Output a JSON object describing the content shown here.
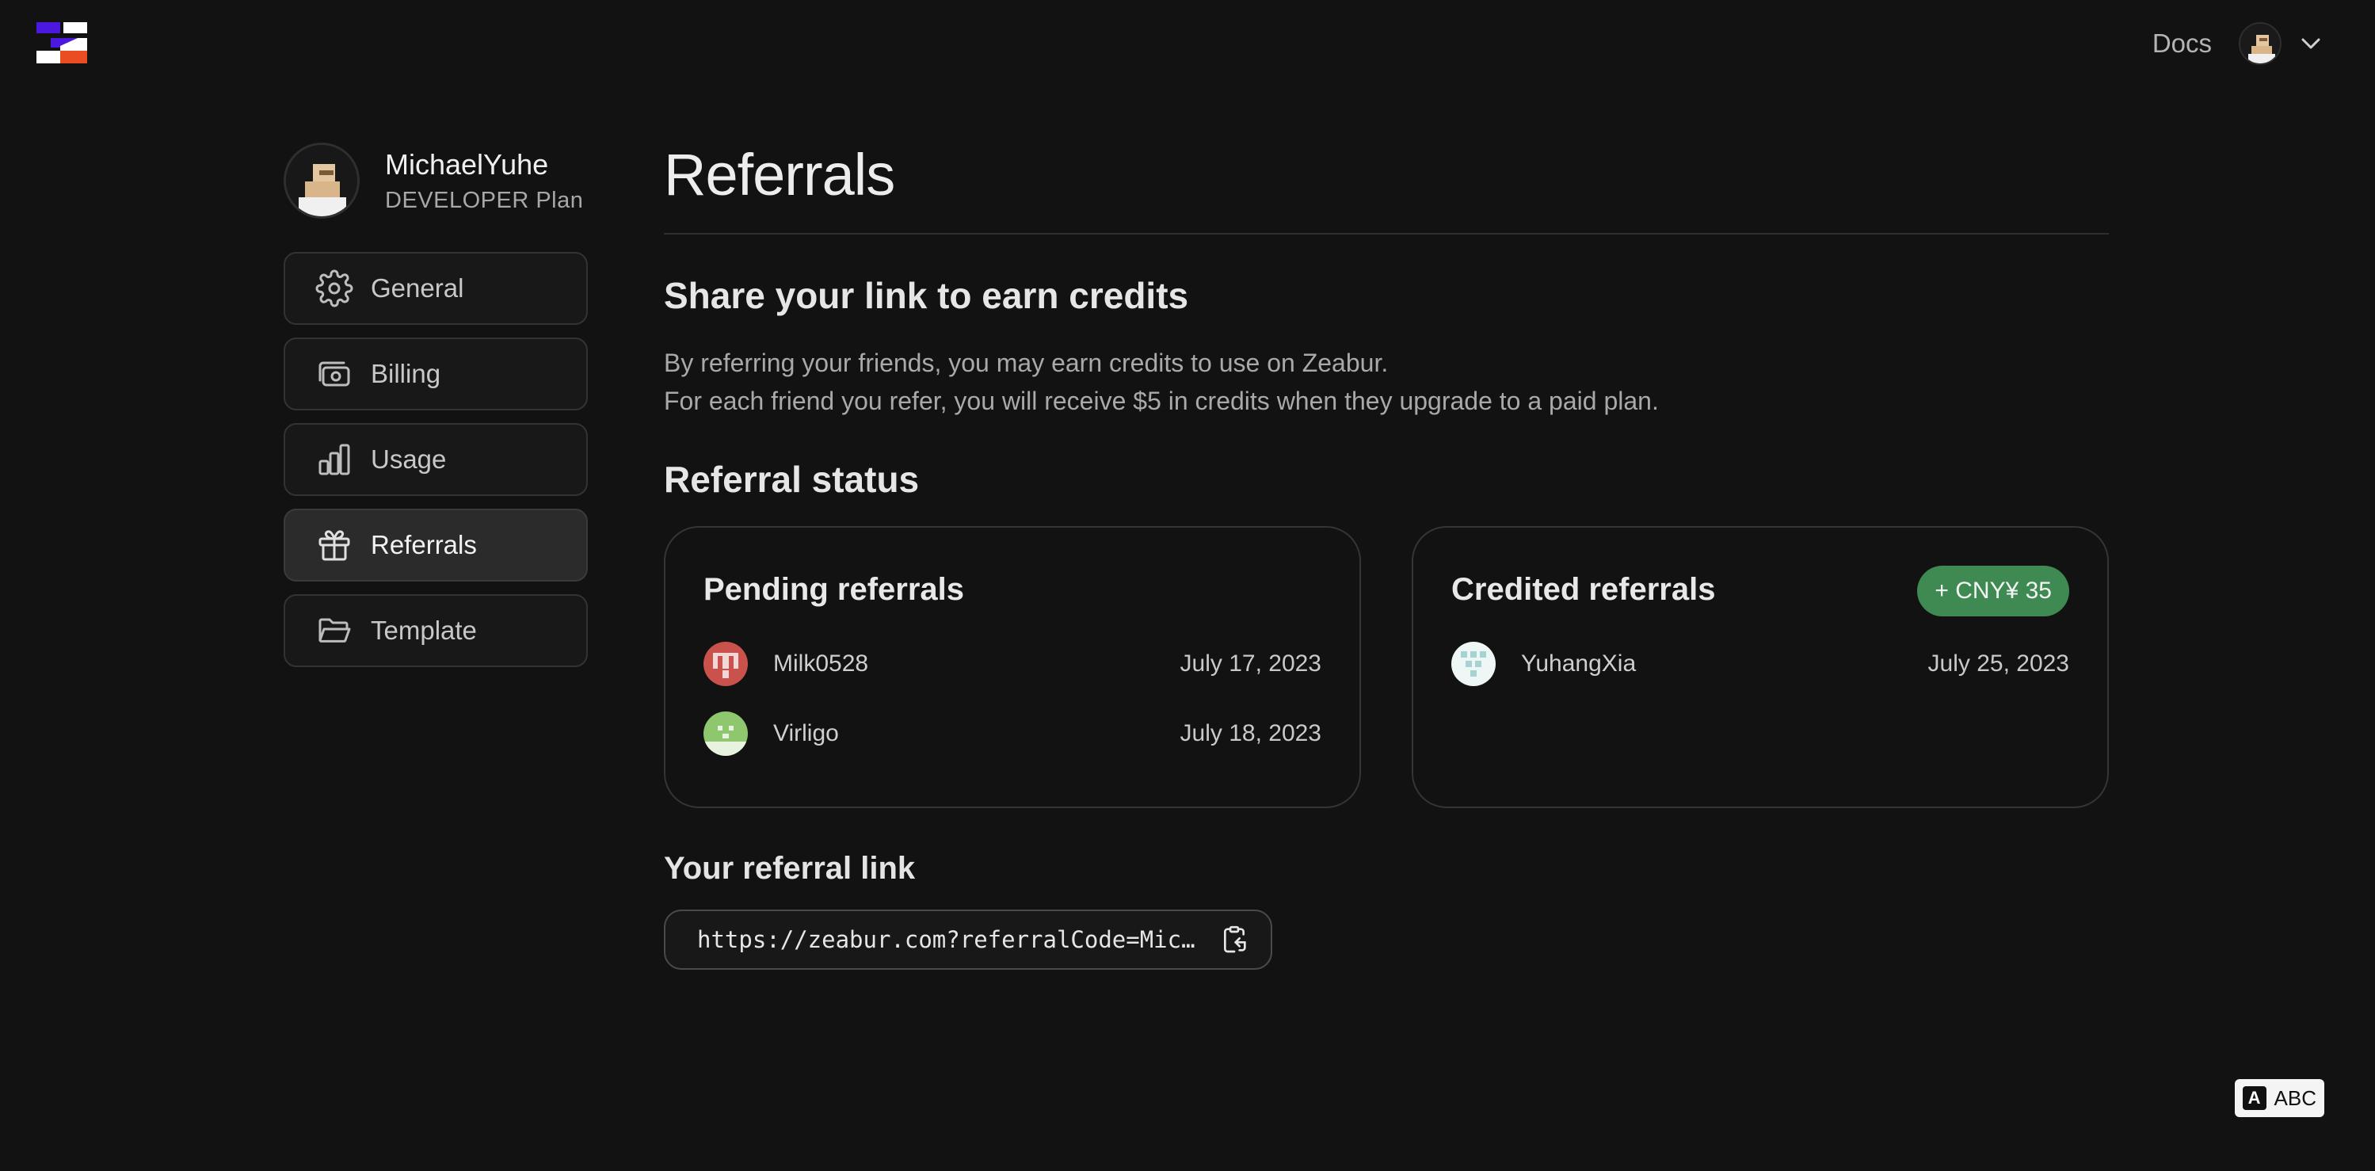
{
  "header": {
    "docs_label": "Docs"
  },
  "profile": {
    "username": "MichaelYuhe",
    "plan": "DEVELOPER Plan"
  },
  "sidebar": {
    "items": [
      {
        "label": "General",
        "icon": "gear-icon"
      },
      {
        "label": "Billing",
        "icon": "billing-icon"
      },
      {
        "label": "Usage",
        "icon": "bar-chart-icon"
      },
      {
        "label": "Referrals",
        "icon": "gift-icon",
        "active": true
      },
      {
        "label": "Template",
        "icon": "folder-icon"
      }
    ]
  },
  "main": {
    "title": "Referrals",
    "share_heading": "Share your link to earn credits",
    "share_desc_1": "By referring your friends, you may earn credits to use on Zeabur.",
    "share_desc_2": "For each friend you refer, you will receive $5 in credits when they upgrade to a paid plan.",
    "status_heading": "Referral status",
    "pending": {
      "title": "Pending referrals",
      "rows": [
        {
          "name": "Milk0528",
          "date": "July 17, 2023"
        },
        {
          "name": "Virligo",
          "date": "July 18, 2023"
        }
      ]
    },
    "credited": {
      "title": "Credited referrals",
      "badge": "+ CNY¥ 35",
      "rows": [
        {
          "name": "YuhangXia",
          "date": "July 25, 2023"
        }
      ]
    },
    "link_heading": "Your referral link",
    "link_value": "https://zeabur.com?referralCode=Micha…"
  },
  "ime": {
    "label": "ABC",
    "glyph": "A"
  },
  "colors": {
    "background": "#121212",
    "badge_green": "#3f8a53",
    "logo_purple": "#4b18e0",
    "logo_orange": "#ea4d22"
  }
}
